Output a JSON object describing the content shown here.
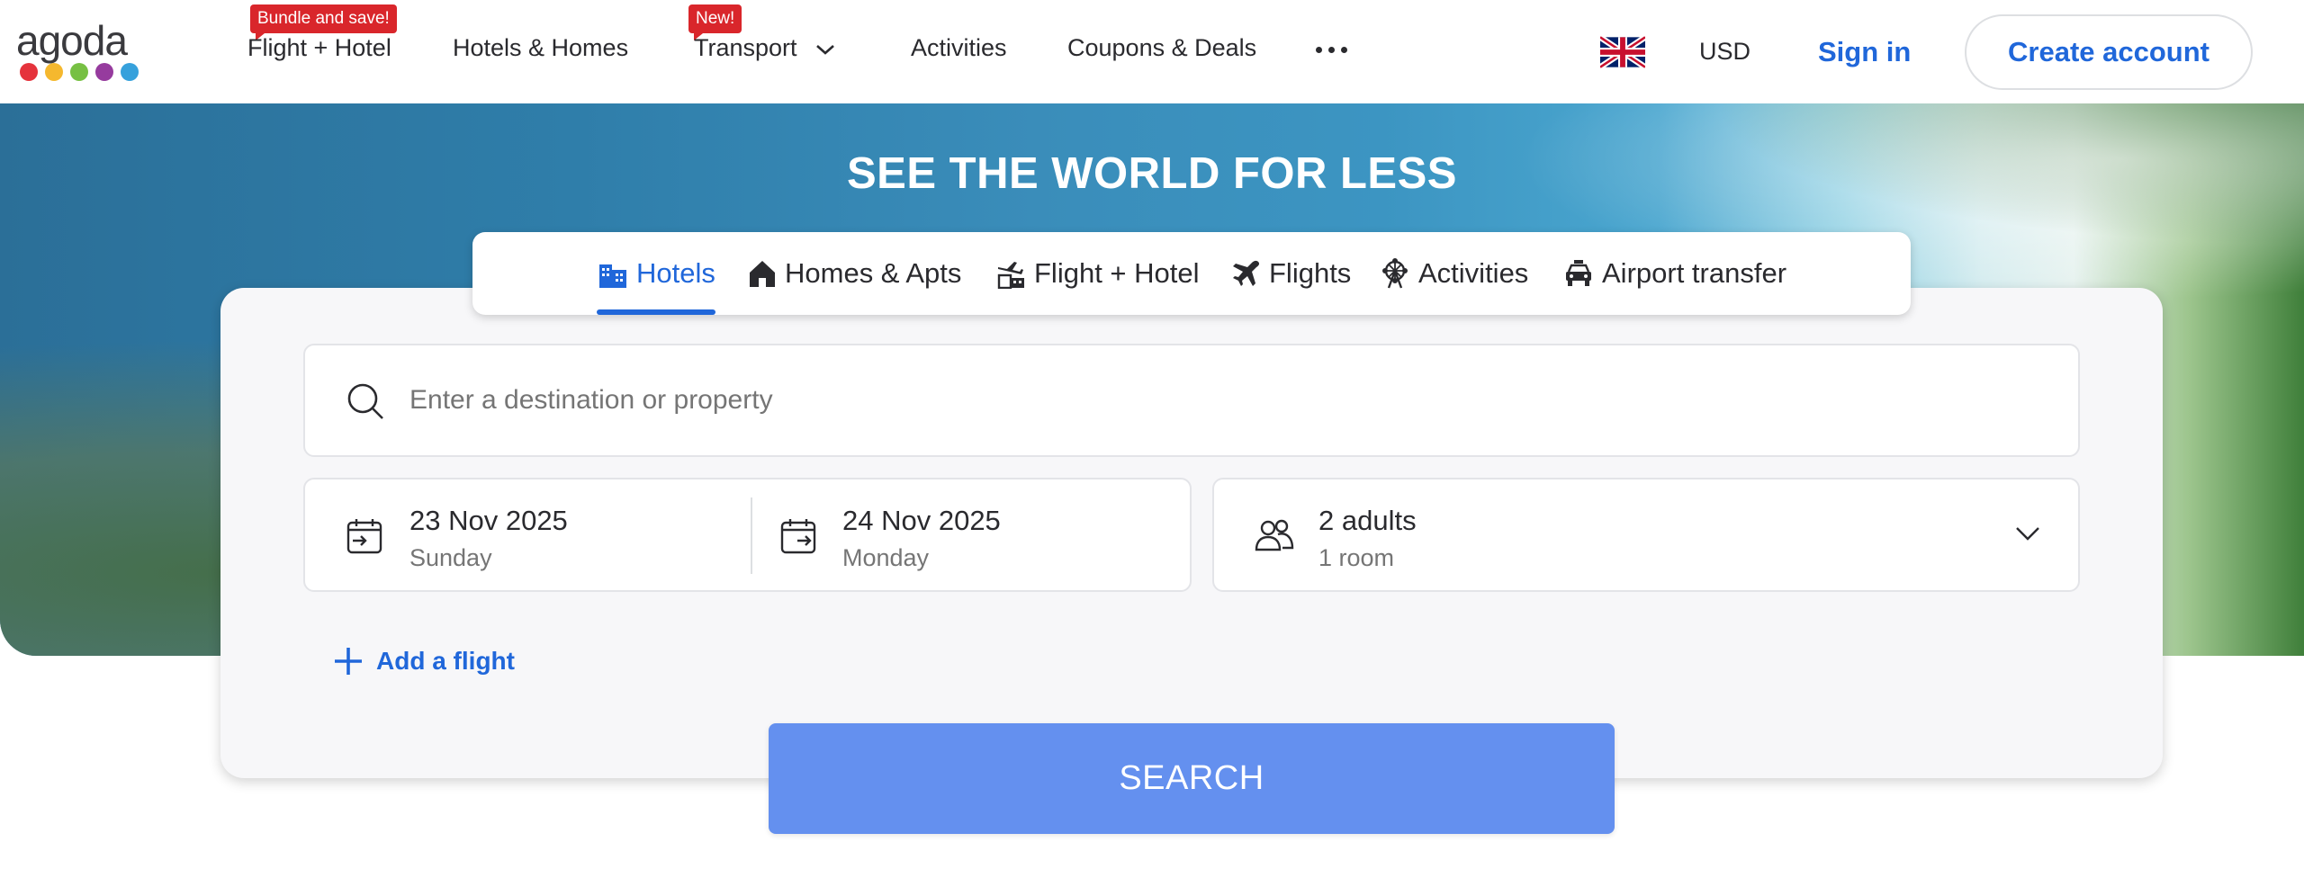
{
  "header": {
    "logo_text": "agoda",
    "logo_colors": [
      "#e5333c",
      "#f5b82e",
      "#77c043",
      "#963b9e",
      "#36a1dc"
    ],
    "nav": [
      {
        "label": "Flight + Hotel",
        "badge": "Bundle and save!"
      },
      {
        "label": "Hotels & Homes"
      },
      {
        "label": "Transport",
        "badge": "New!"
      },
      {
        "label": "Activities"
      },
      {
        "label": "Coupons & Deals"
      }
    ],
    "currency": "USD",
    "sign_in": "Sign in",
    "create_account": "Create account"
  },
  "hero": {
    "title": "SEE THE WORLD FOR LESS"
  },
  "tabs": [
    {
      "label": "Hotels",
      "icon": "hotel-building-icon",
      "active": true
    },
    {
      "label": "Homes & Apts",
      "icon": "house-icon"
    },
    {
      "label": "Flight + Hotel",
      "icon": "plane-building-icon"
    },
    {
      "label": "Flights",
      "icon": "airplane-icon"
    },
    {
      "label": "Activities",
      "icon": "ferris-wheel-icon"
    },
    {
      "label": "Airport transfer",
      "icon": "car-icon"
    }
  ],
  "search": {
    "placeholder": "Enter a destination or property",
    "check_in": {
      "date": "23 Nov 2025",
      "day": "Sunday"
    },
    "check_out": {
      "date": "24 Nov 2025",
      "day": "Monday"
    },
    "guests": {
      "adults": "2 adults",
      "rooms": "1 room"
    },
    "add_flight": "Add a flight",
    "button": "SEARCH"
  },
  "colors": {
    "accent": "#2067da",
    "search_button": "#6490ef",
    "badge": "#d9262b"
  }
}
